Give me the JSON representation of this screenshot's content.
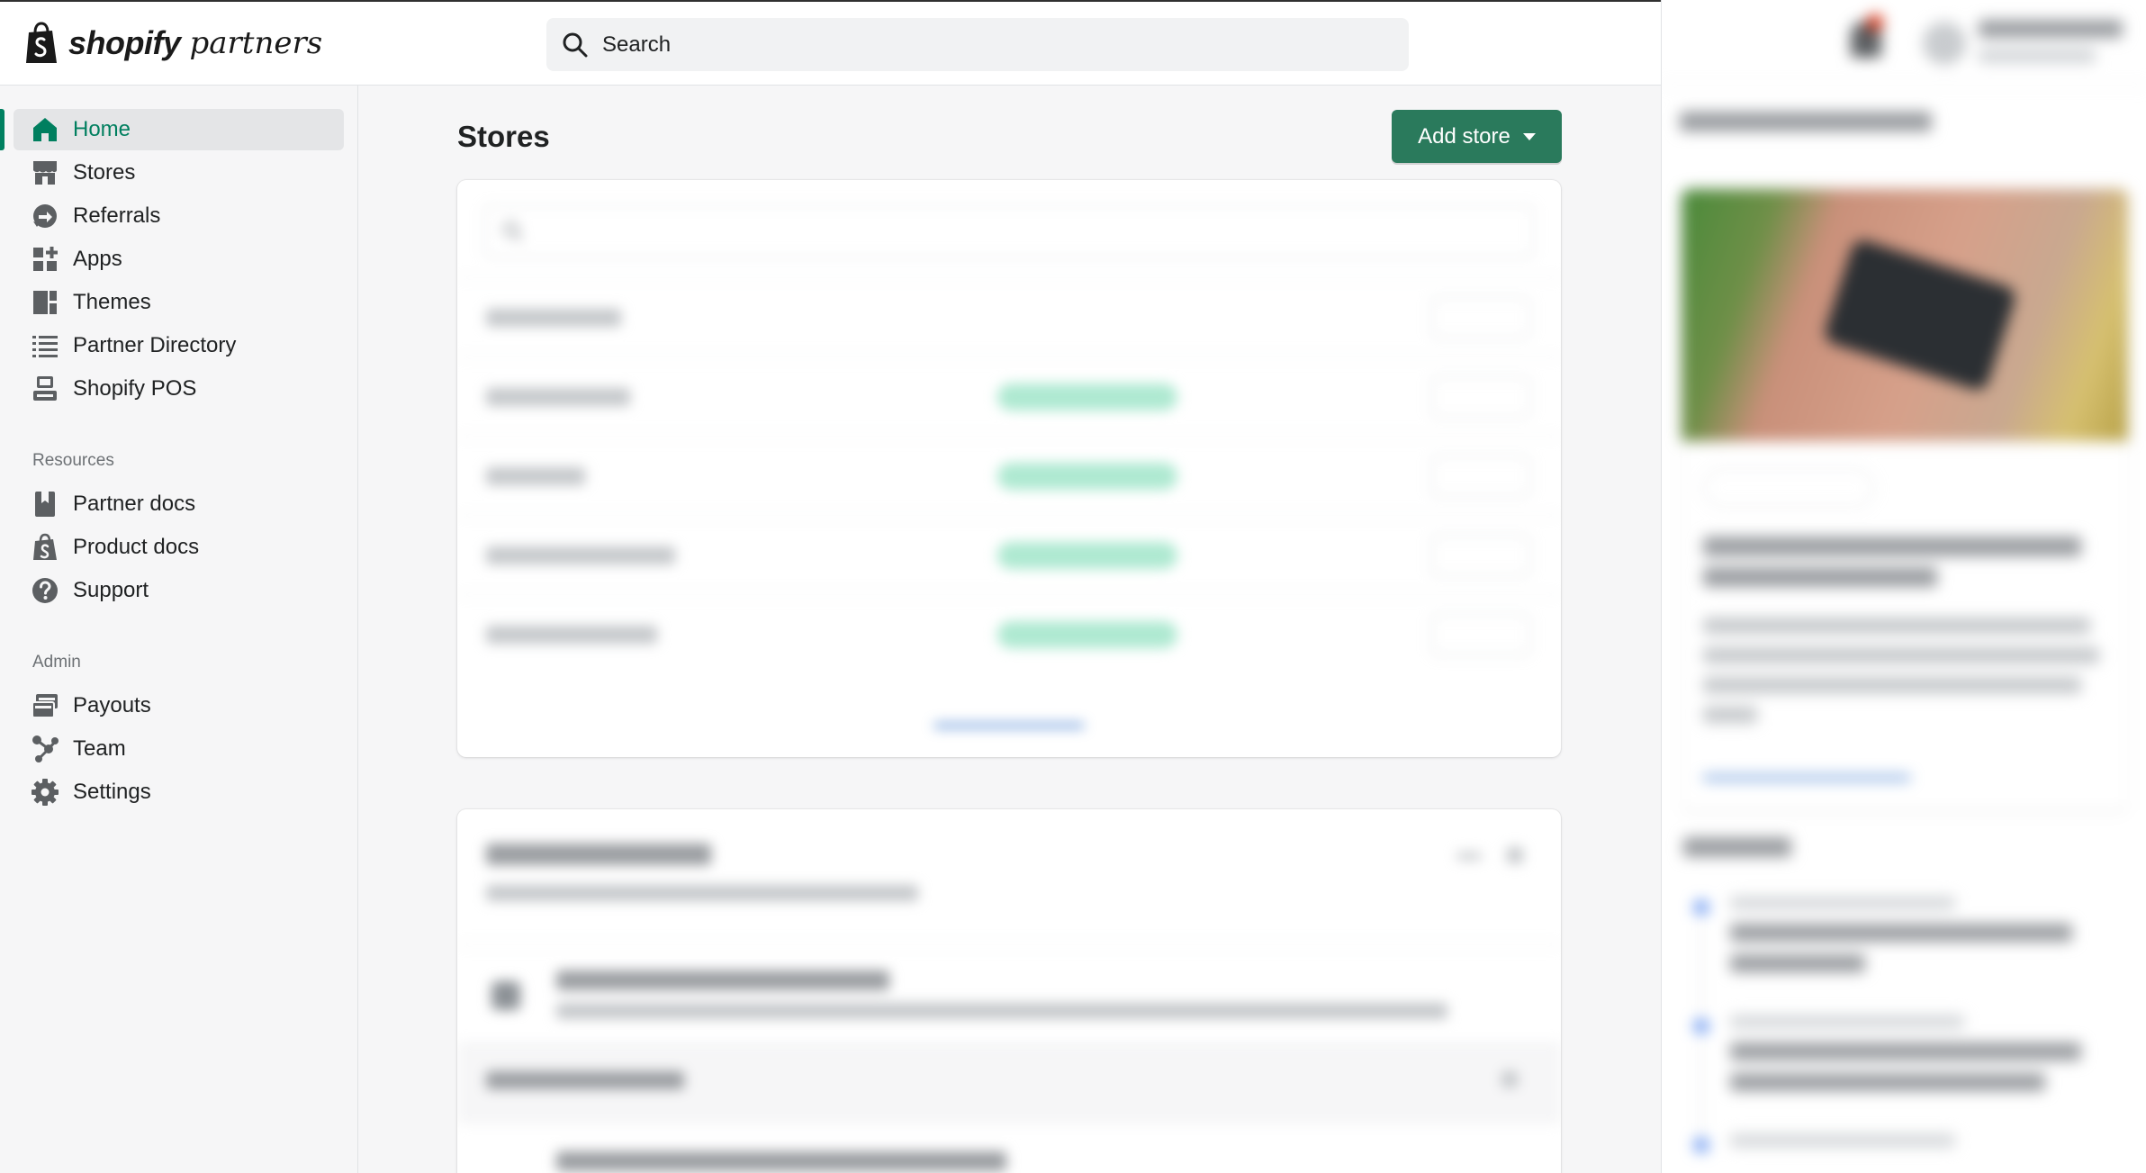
{
  "topbar": {
    "logo_strong": "shopify",
    "logo_light": "partners",
    "search_placeholder": "Search"
  },
  "sidebar": {
    "main_items": [
      {
        "label": "Home",
        "icon": "home-icon",
        "active": true
      },
      {
        "label": "Stores",
        "icon": "store-icon"
      },
      {
        "label": "Referrals",
        "icon": "referral-icon"
      },
      {
        "label": "Apps",
        "icon": "apps-icon"
      },
      {
        "label": "Themes",
        "icon": "themes-icon"
      },
      {
        "label": "Partner Directory",
        "icon": "list-icon"
      },
      {
        "label": "Shopify POS",
        "icon": "pos-icon"
      }
    ],
    "resources_heading": "Resources",
    "resources_items": [
      {
        "label": "Partner docs",
        "icon": "bookmark-icon"
      },
      {
        "label": "Product docs",
        "icon": "shopify-bag-icon"
      },
      {
        "label": "Support",
        "icon": "question-icon"
      }
    ],
    "admin_heading": "Admin",
    "admin_items": [
      {
        "label": "Payouts",
        "icon": "payouts-icon"
      },
      {
        "label": "Team",
        "icon": "team-icon"
      },
      {
        "label": "Settings",
        "icon": "gear-icon"
      }
    ]
  },
  "main": {
    "page_title": "Stores",
    "add_store_label": "Add store"
  },
  "colors": {
    "accent_green": "#2a7a5c",
    "active_text": "#007f5f",
    "sidebar_bg": "#f6f6f7"
  }
}
